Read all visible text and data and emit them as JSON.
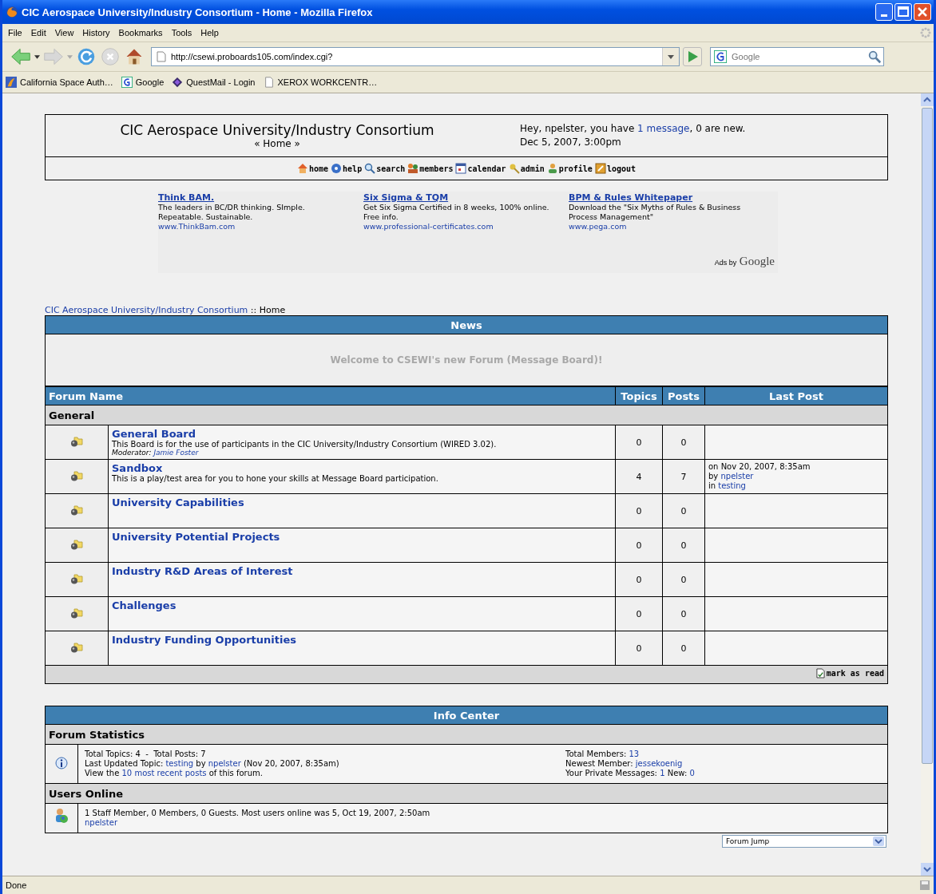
{
  "window": {
    "title": "CIC Aerospace University/Industry Consortium - Home - Mozilla Firefox"
  },
  "menu_bar": [
    "File",
    "Edit",
    "View",
    "History",
    "Bookmarks",
    "Tools",
    "Help"
  ],
  "address_bar": {
    "url": "http://csewi.proboards105.com/index.cgi?"
  },
  "search_box": {
    "placeholder": "Google"
  },
  "bookmarks": [
    {
      "label": "California Space Auth…",
      "kind": "site"
    },
    {
      "label": "Google",
      "kind": "google"
    },
    {
      "label": "QuestMail - Login",
      "kind": "diamond"
    },
    {
      "label": "XEROX WORKCENTR…",
      "kind": "page"
    }
  ],
  "header": {
    "site_title": "CIC Aerospace University/Industry Consortium",
    "subtitle": "« Home »",
    "greeting": [
      {
        "text": "Hey, npelster, you have ",
        "kind": "text"
      },
      {
        "text": "1 message",
        "kind": "link"
      },
      {
        "text": ", 0 are new.",
        "kind": "text"
      }
    ],
    "date": "Dec 5, 2007, 3:00pm"
  },
  "nav_links": [
    {
      "label": "home",
      "kind": "home"
    },
    {
      "label": "help",
      "kind": "help"
    },
    {
      "label": "search",
      "kind": "search"
    },
    {
      "label": "members",
      "kind": "members"
    },
    {
      "label": "calendar",
      "kind": "calendar"
    },
    {
      "label": "admin",
      "kind": "admin"
    },
    {
      "label": "profile",
      "kind": "profile"
    },
    {
      "label": "logout",
      "kind": "logout"
    }
  ],
  "ads": [
    {
      "title": "Think BAM.",
      "text": "The leaders in BC/DR thinking. SImple. Repeatable. Sustainable.",
      "url": "www.ThinkBam.com"
    },
    {
      "title": "Six Sigma & TQM",
      "text": "Get Six Sigma Certified in 8 weeks, 100% online. Free info.",
      "url": "www.professional-certificates.com"
    },
    {
      "title": "BPM & Rules Whitepaper",
      "text": "Download the \"Six Myths of Rules & Business Process Management\"",
      "url": "www.pega.com"
    }
  ],
  "ads_label": {
    "prefix": "Ads by",
    "brand": "Google"
  },
  "breadcrumb": {
    "link": "CIC Aerospace University/Industry Consortium",
    "rest": " :: Home"
  },
  "news": {
    "title": "News",
    "message": "Welcome to CSEWI's new Forum (Message Board)!"
  },
  "forum_table": {
    "columns": [
      "Forum Name",
      "Topics",
      "Posts",
      "Last Post"
    ],
    "category": "General",
    "rows": [
      {
        "name": "General Board",
        "description": "This Board is for the use of participants in the CIC University/Industry Consortium (WIRED 3.02).",
        "moderator_label": "Moderator:",
        "moderator": "Jamie Foster",
        "topics": "0",
        "posts": "0"
      },
      {
        "name": "Sandbox",
        "description": "This is a play/test area for you to hone your skills at Message Board participation.",
        "topics": "4",
        "posts": "7",
        "last_post": [
          [
            {
              "text": "on Nov 20, 2007, 8:35am",
              "kind": "text"
            }
          ],
          [
            {
              "text": "by ",
              "kind": "text"
            },
            {
              "text": "npelster",
              "kind": "link"
            }
          ],
          [
            {
              "text": "in ",
              "kind": "text"
            },
            {
              "text": "testing",
              "kind": "link"
            }
          ]
        ]
      },
      {
        "name": "University Capabilities",
        "topics": "0",
        "posts": "0"
      },
      {
        "name": "University Potential Projects",
        "topics": "0",
        "posts": "0"
      },
      {
        "name": "Industry R&D Areas of Interest",
        "topics": "0",
        "posts": "0"
      },
      {
        "name": "Challenges",
        "topics": "0",
        "posts": "0"
      },
      {
        "name": "Industry Funding Opportunities",
        "topics": "0",
        "posts": "0"
      }
    ],
    "mark_read": "mark as read"
  },
  "info_center": {
    "title": "Info Center",
    "stats_title": "Forum Statistics",
    "stats_left": [
      [
        {
          "text": "Total Topics: 4  -  Total Posts: 7",
          "kind": "text"
        }
      ],
      [
        {
          "text": "Last Updated Topic: ",
          "kind": "text"
        },
        {
          "text": "testing",
          "kind": "link"
        },
        {
          "text": " by ",
          "kind": "text"
        },
        {
          "text": "npelster",
          "kind": "link"
        },
        {
          "text": " (Nov 20, 2007, 8:35am)",
          "kind": "text"
        }
      ],
      [
        {
          "text": "View the ",
          "kind": "text"
        },
        {
          "text": "10 most recent posts",
          "kind": "link"
        },
        {
          "text": " of this forum.",
          "kind": "text"
        }
      ]
    ],
    "stats_right": [
      [
        {
          "text": "Total Members: ",
          "kind": "text"
        },
        {
          "text": "13",
          "kind": "link"
        }
      ],
      [
        {
          "text": "Newest Member: ",
          "kind": "text"
        },
        {
          "text": "jessekoenig",
          "kind": "link"
        }
      ],
      [
        {
          "text": "Your Private Messages: ",
          "kind": "text"
        },
        {
          "text": "1",
          "kind": "link"
        },
        {
          "text": " New: ",
          "kind": "text"
        },
        {
          "text": "0",
          "kind": "link"
        }
      ]
    ],
    "online_title": "Users Online",
    "online_text": "1 Staff Member, 0 Members, 0 Guests. Most users online was 5, Oct 19, 2007, 2:50am",
    "online_users": [
      "npelster"
    ]
  },
  "forum_jump": {
    "value": "Forum Jump"
  },
  "status_bar": {
    "text": "Done"
  }
}
